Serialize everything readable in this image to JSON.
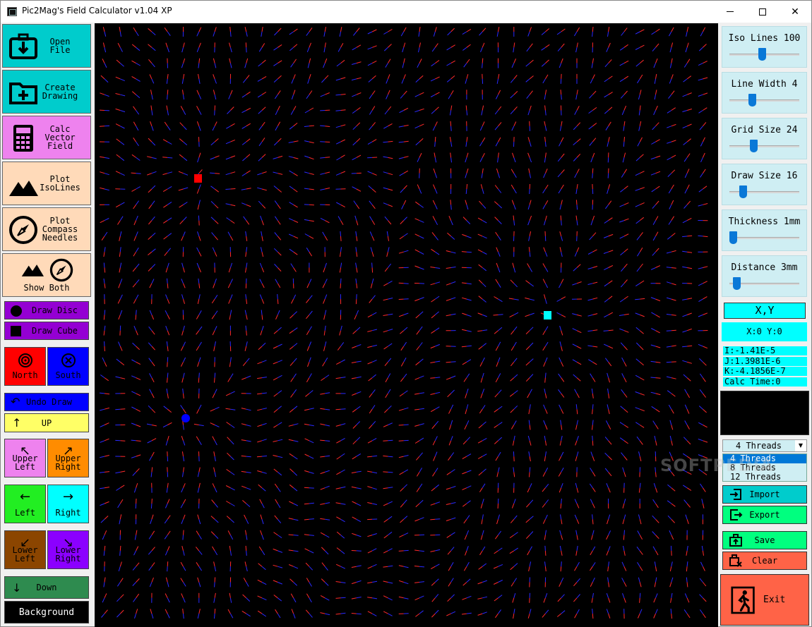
{
  "window": {
    "title": "Pic2Mag's Field Calculator v1.04 XP"
  },
  "left_panel": {
    "open_file": "Open\nFile",
    "create_drawing": "Create\nDrawing",
    "calc_vector_field": "Calc\nVector\nField",
    "plot_isolines": "Plot\nIsoLines",
    "plot_compass": "Plot\nCompass\nNeedles",
    "show_both": "Show Both",
    "draw_disc": "Draw Disc",
    "draw_cube": "Draw Cube",
    "north": "North",
    "south": "South",
    "undo_draw": "Undo Draw",
    "up": "UP",
    "upper_left": "Upper\nLeft",
    "upper_right": "Upper\nRight",
    "left": "Left",
    "right": "Right",
    "lower_left": "Lower\nLeft",
    "lower_right": "Lower\nRight",
    "down": "Down",
    "background": "Background"
  },
  "right_panel": {
    "sliders": [
      {
        "label": "Iso Lines 100",
        "value": 0.45
      },
      {
        "label": "Line Width 4",
        "value": 0.3
      },
      {
        "label": "Grid Size 24",
        "value": 0.32
      },
      {
        "label": "Draw Size 16",
        "value": 0.15
      },
      {
        "label": "Thickness 1mm",
        "value": 0.0
      },
      {
        "label": "Distance 3mm",
        "value": 0.05
      }
    ],
    "xy_header": "X,Y",
    "xy_value": "X:0 Y:0",
    "i_value": "I:-1.41E-5",
    "j_value": "J:1.3981E-6",
    "k_value": "K:-4.1856E-7",
    "calc_time": "Calc Time:0",
    "threads_selected": "4 Threads",
    "threads_options": [
      "4 Threads",
      "8 Threads",
      "12 Threads"
    ],
    "import": "Import",
    "export": "Export",
    "save": "Save",
    "clear": "Clear",
    "exit": "Exit"
  },
  "watermark": "SOFTPEDIA",
  "colors": {
    "cyan_btn": "#00cccc",
    "pink_btn": "#ee82ee",
    "peach_btn": "#ffdab9",
    "purple_btn": "#9400d3",
    "north": "#ff0000",
    "south": "#0000ff",
    "canvas": "#000000",
    "needle_a": "#ff2a2a",
    "needle_b": "#2a2aff"
  }
}
